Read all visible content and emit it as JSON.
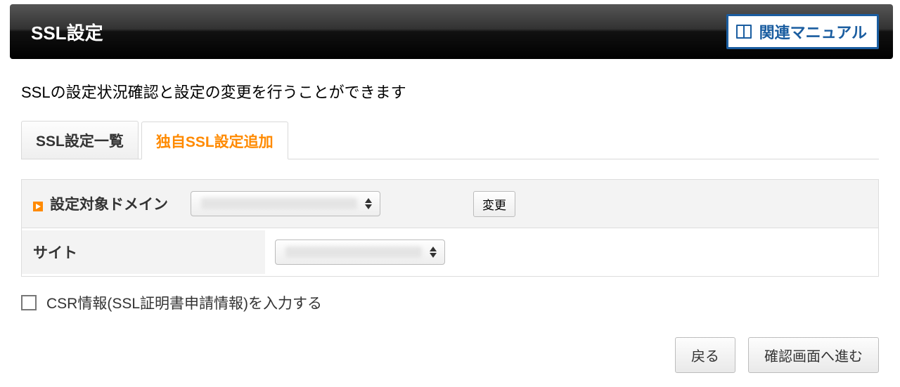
{
  "header": {
    "title": "SSL設定",
    "manual_label": "関連マニュアル"
  },
  "description": "SSLの設定状況確認と設定の変更を行うことができます",
  "tabs": {
    "list": {
      "label": "SSL設定一覧"
    },
    "add": {
      "label": "独自SSL設定追加"
    }
  },
  "form": {
    "domain_label": "設定対象ドメイン",
    "change_label": "変更",
    "site_label": "サイト"
  },
  "checkbox": {
    "label": "CSR情報(SSL証明書申請情報)を入力する"
  },
  "buttons": {
    "back": "戻る",
    "confirm": "確認画面へ進む"
  }
}
